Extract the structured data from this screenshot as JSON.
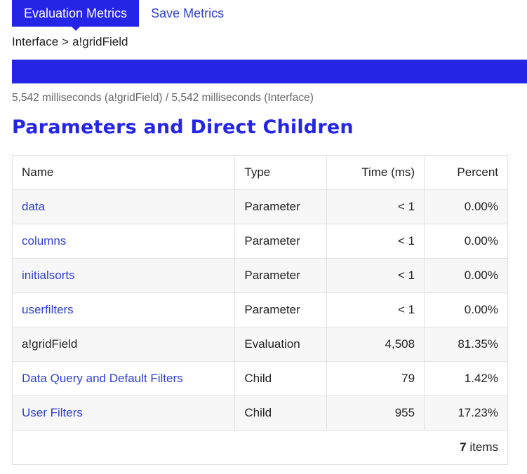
{
  "tabs": [
    {
      "label": "Evaluation Metrics",
      "active": true
    },
    {
      "label": "Save Metrics",
      "active": false
    }
  ],
  "breadcrumb": {
    "parent": "Interface",
    "separator": ">",
    "current": "a!gridField"
  },
  "progress": {
    "percent_of_interface": 100
  },
  "timing_text": "5,542 milliseconds (a!gridField) / 5,542 milliseconds (Interface)",
  "section_title": "Parameters and Direct Children",
  "table": {
    "headers": {
      "name": "Name",
      "type": "Type",
      "time": "Time (ms)",
      "percent": "Percent"
    },
    "rows": [
      {
        "name": "data",
        "type": "Parameter",
        "time": "< 1",
        "percent": "0.00%",
        "link": true
      },
      {
        "name": "columns",
        "type": "Parameter",
        "time": "< 1",
        "percent": "0.00%",
        "link": true
      },
      {
        "name": "initialsorts",
        "type": "Parameter",
        "time": "< 1",
        "percent": "0.00%",
        "link": true
      },
      {
        "name": "userfilters",
        "type": "Parameter",
        "time": "< 1",
        "percent": "0.00%",
        "link": true
      },
      {
        "name": "a!gridField",
        "type": "Evaluation",
        "time": "4,508",
        "percent": "81.35%",
        "link": false
      },
      {
        "name": "Data Query and Default Filters",
        "type": "Child",
        "time": "79",
        "percent": "1.42%",
        "link": true
      },
      {
        "name": "User Filters",
        "type": "Child",
        "time": "955",
        "percent": "17.23%",
        "link": true
      }
    ],
    "item_count": "7",
    "item_count_suffix": "items"
  },
  "colors": {
    "accent": "#2525e6",
    "link": "#2d3fd1",
    "muted_text": "#666666"
  }
}
